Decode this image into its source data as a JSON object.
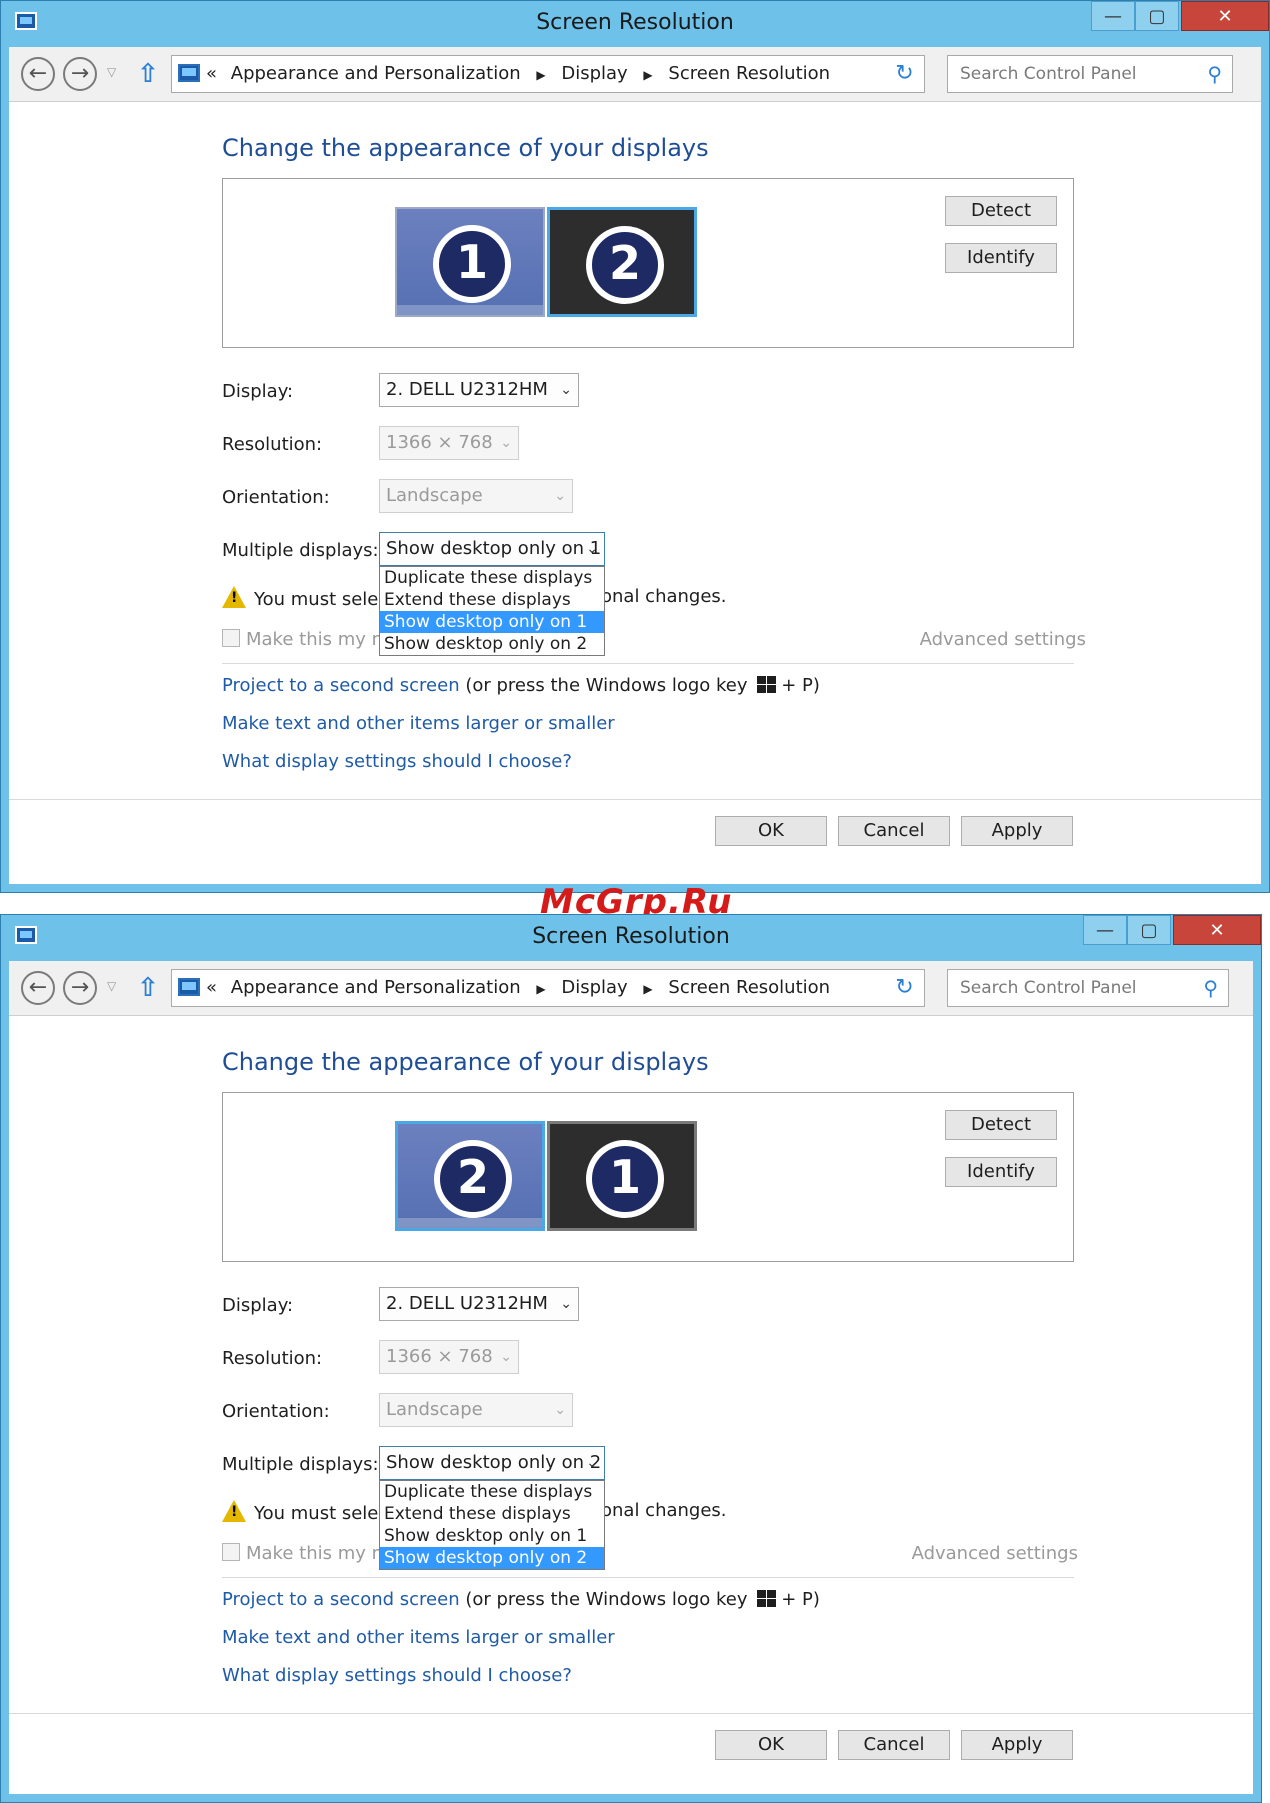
{
  "watermark": "McGrp.Ru",
  "window_common": {
    "title": "Screen Resolution",
    "caption": {
      "minimize": "—",
      "maximize": "▢",
      "close": "✕"
    },
    "nav": {
      "back": "←",
      "forward": "→",
      "dropdown": "▽",
      "up": "⇧"
    },
    "breadcrumb": {
      "prefix": "«",
      "items": [
        "Appearance and Personalization",
        "Display",
        "Screen Resolution"
      ],
      "separator": "▶"
    },
    "address_chevron": "⌄",
    "refresh": "↻",
    "search": {
      "placeholder": "Search Control Panel",
      "icon": "⚲"
    },
    "heading": "Change the appearance of your displays",
    "detect_label": "Detect",
    "identify_label": "Identify",
    "display_label": "Display:",
    "display_value": "2. DELL U2312HM",
    "resolution_label": "Resolution:",
    "resolution_value": "1366 × 768",
    "orientation_label": "Orientation:",
    "orientation_value": "Landscape",
    "multiple_label": "Multiple displays:",
    "dropdown_options": [
      "Duplicate these displays",
      "Extend these displays",
      "Show desktop only on 1",
      "Show desktop only on 2"
    ],
    "warning_text": "You must selec",
    "warning_tail": "onal changes.",
    "checkbox_text": "Make this my ma",
    "advanced_settings": "Advanced settings",
    "project_link": "Project to a second screen",
    "project_rest_a": "(or press the Windows logo key",
    "project_rest_b": "+ P)",
    "link_text_size": "Make text and other items larger or smaller",
    "link_which": "What display settings should I choose?",
    "ok_label": "OK",
    "cancel_label": "Cancel",
    "apply_label": "Apply",
    "chevron": "⌄"
  },
  "window1": {
    "monitors": [
      "1",
      "2"
    ],
    "multiple_value": "Show desktop only on 1",
    "highlighted_option": 2
  },
  "window2": {
    "monitors": [
      "2",
      "1"
    ],
    "multiple_value": "Show desktop only on 2",
    "highlighted_option": 3
  }
}
